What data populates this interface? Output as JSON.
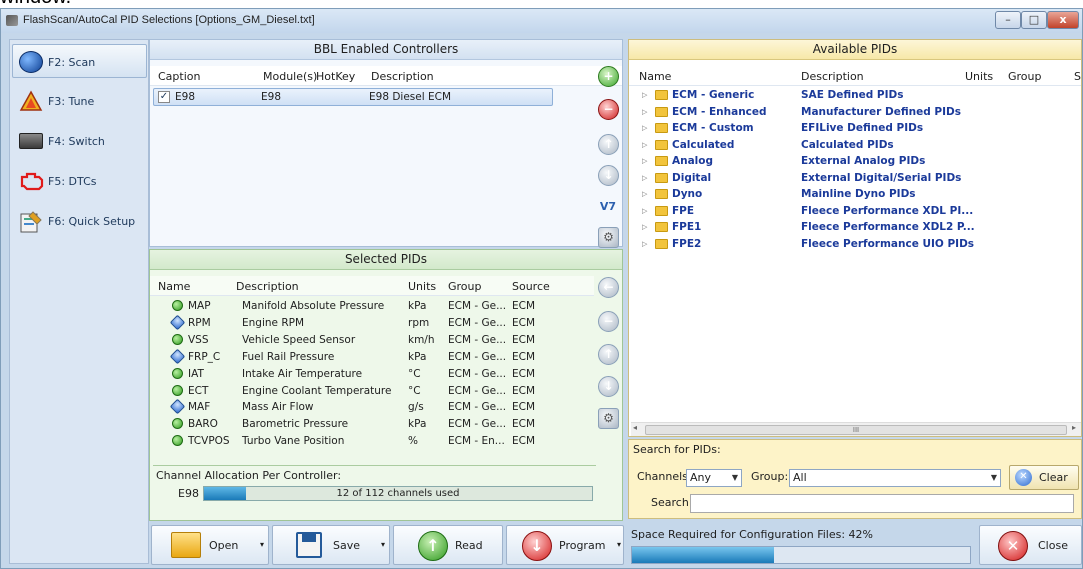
{
  "caption_fragment": "window.",
  "titlebar": {
    "title": "FlashScan/AutoCal PID Selections [Options_GM_Diesel.txt]",
    "min": "–",
    "max": "□",
    "close": "x"
  },
  "sidebar": {
    "items": [
      {
        "label": "F2: Scan",
        "icon": "globe-icon"
      },
      {
        "label": "F3: Tune",
        "icon": "triangle-icon"
      },
      {
        "label": "F4: Switch",
        "icon": "switch-icon"
      },
      {
        "label": "F5: DTCs",
        "icon": "engine-icon"
      },
      {
        "label": "F6: Quick Setup",
        "icon": "setup-icon"
      }
    ]
  },
  "bbl": {
    "title": "BBL Enabled Controllers",
    "headers": [
      "Caption",
      "Module(s)",
      "HotKey",
      "Description"
    ],
    "rows": [
      {
        "checked": "✓",
        "caption": "E98",
        "module": "E98",
        "hotkey": "",
        "description": "E98 Diesel ECM"
      }
    ],
    "v7_label": "V7"
  },
  "selected": {
    "title": "Selected PIDs",
    "headers": [
      "Name",
      "Description",
      "Units",
      "Group",
      "Source"
    ],
    "rows": [
      {
        "name": "MAP",
        "description": "Manifold Absolute Pressure",
        "units": "kPa",
        "group": "ECM - Ge...",
        "source": "ECM",
        "type": "green"
      },
      {
        "name": "RPM",
        "description": "Engine RPM",
        "units": "rpm",
        "group": "ECM - Ge...",
        "source": "ECM",
        "type": "blue"
      },
      {
        "name": "VSS",
        "description": "Vehicle Speed Sensor",
        "units": "km/h",
        "group": "ECM - Ge...",
        "source": "ECM",
        "type": "green"
      },
      {
        "name": "FRP_C",
        "description": "Fuel Rail Pressure",
        "units": "kPa",
        "group": "ECM - Ge...",
        "source": "ECM",
        "type": "blue"
      },
      {
        "name": "IAT",
        "description": "Intake Air Temperature",
        "units": "°C",
        "group": "ECM - Ge...",
        "source": "ECM",
        "type": "green"
      },
      {
        "name": "ECT",
        "description": "Engine Coolant Temperature",
        "units": "°C",
        "group": "ECM - Ge...",
        "source": "ECM",
        "type": "green"
      },
      {
        "name": "MAF",
        "description": "Mass Air Flow",
        "units": "g/s",
        "group": "ECM - Ge...",
        "source": "ECM",
        "type": "blue"
      },
      {
        "name": "BARO",
        "description": "Barometric Pressure",
        "units": "kPa",
        "group": "ECM - Ge...",
        "source": "ECM",
        "type": "green"
      },
      {
        "name": "TCVPOS",
        "description": "Turbo Vane Position",
        "units": "%",
        "group": "ECM - En...",
        "source": "ECM",
        "type": "green"
      }
    ]
  },
  "channels": {
    "title": "Channel Allocation Per Controller:",
    "controller": "E98",
    "text": "12 of 112 channels used",
    "used_fraction": 0.107
  },
  "available": {
    "title": "Available PIDs",
    "headers": [
      "Name",
      "Description",
      "Units",
      "Group",
      "S"
    ],
    "rows": [
      {
        "name": "ECM - Generic",
        "description": "SAE Defined PIDs"
      },
      {
        "name": "ECM - Enhanced",
        "description": "Manufacturer Defined PIDs"
      },
      {
        "name": "ECM - Custom",
        "description": "EFILive Defined PIDs"
      },
      {
        "name": "Calculated",
        "description": "Calculated PIDs"
      },
      {
        "name": "Analog",
        "description": "External Analog PIDs"
      },
      {
        "name": "Digital",
        "description": "External Digital/Serial PIDs"
      },
      {
        "name": "Dyno",
        "description": "Mainline Dyno PIDs"
      },
      {
        "name": "FPE",
        "description": "Fleece Performance XDL PI..."
      },
      {
        "name": "FPE1",
        "description": "Fleece Performance XDL2 P..."
      },
      {
        "name": "FPE2",
        "description": "Fleece Performance UIO PIDs"
      }
    ],
    "scroll_thumb_glyph": "III"
  },
  "search": {
    "title": "Search for PIDs:",
    "channels_label": "Channels:",
    "channels_value": "Any",
    "group_label": "Group:",
    "group_value": "All",
    "clear_label": "Clear",
    "search_label": "Search:",
    "search_value": ""
  },
  "bottom": {
    "open_label": "Open",
    "save_label": "Save",
    "read_label": "Read",
    "program_label": "Program",
    "space_label": "Space Required for Configuration Files: 42%",
    "space_fraction": 0.42,
    "close_label": "Close"
  },
  "colors": {
    "accent": "#1b3a9a",
    "progress": "#1a8bc6",
    "panel_bg": "#c5d7ea",
    "available_bg": "#fff8dc",
    "selected_bg": "#eef8ea"
  }
}
